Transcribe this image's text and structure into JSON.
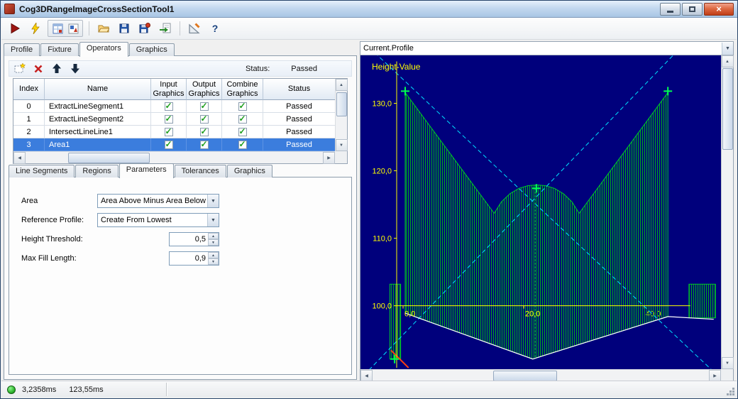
{
  "window": {
    "title": "Cog3DRangeImageCrossSectionTool1"
  },
  "glyphs": {
    "dropdown": "▼",
    "spin_up": "▲",
    "spin_down": "▼",
    "scroll_up": "▲",
    "scroll_down": "▼",
    "scroll_left": "◀",
    "scroll_right": "▶",
    "close": "×",
    "help": "?"
  },
  "toolbar": {
    "icons": {
      "run": "red-play-triangle",
      "run_once": "lightning-bolt",
      "display_grid": "grid-window",
      "display_image": "image-window",
      "open": "folder",
      "save": "floppy-disk",
      "save_record": "floppy-disk-record",
      "import": "page-import-arrow",
      "setup": "set-square-pencil",
      "help": "question-mark"
    }
  },
  "tabs": {
    "main": [
      "Profile",
      "Fixture",
      "Operators",
      "Graphics"
    ],
    "active_main": "Operators",
    "sub": [
      "Line Segments",
      "Regions",
      "Parameters",
      "Tolerances",
      "Graphics"
    ],
    "active_sub": "Parameters"
  },
  "operators": {
    "status_label": "Status:",
    "status_value": "Passed",
    "selected_index": 3,
    "columns": [
      {
        "line1": "Index",
        "line2": ""
      },
      {
        "line1": "Name",
        "line2": ""
      },
      {
        "line1": "Input",
        "line2": "Graphics"
      },
      {
        "line1": "Output",
        "line2": "Graphics"
      },
      {
        "line1": "Combine",
        "line2": "Graphics"
      },
      {
        "line1": "Status",
        "line2": ""
      }
    ],
    "rows": [
      {
        "index": "0",
        "name": "ExtractLineSegment1",
        "input_graphics": true,
        "output_graphics": true,
        "combine_graphics": true,
        "status": "Passed"
      },
      {
        "index": "1",
        "name": "ExtractLineSegment2",
        "input_graphics": true,
        "output_graphics": true,
        "combine_graphics": true,
        "status": "Passed"
      },
      {
        "index": "2",
        "name": "IntersectLineLine1",
        "input_graphics": true,
        "output_graphics": true,
        "combine_graphics": true,
        "status": "Passed"
      },
      {
        "index": "3",
        "name": "Area1",
        "input_graphics": true,
        "output_graphics": true,
        "combine_graphics": true,
        "status": "Passed"
      }
    ]
  },
  "parameters": {
    "area_label": "Area",
    "area_value": "Area Above Minus Area Below",
    "reference_profile_label": "Reference Profile:",
    "reference_profile_value": "Create From Lowest",
    "height_threshold_label": "Height Threshold:",
    "height_threshold_value": "0,5",
    "max_fill_length_label": "Max Fill Length:",
    "max_fill_length_value": "0,9"
  },
  "profile_view": {
    "selector_value": "Current.Profile"
  },
  "status_bar": {
    "time1": "3,2358ms",
    "time2": "123,55ms"
  },
  "chart_data": {
    "type": "area",
    "title": "Current.Profile",
    "axis_label": "Height-Value",
    "xlim": [
      -7.06,
      52.7
    ],
    "ylim": [
      90.6,
      137.1
    ],
    "x_axis": {
      "y": 100,
      "from": -1.06,
      "to": 47.6
    },
    "y_axis": {
      "x": -1.06,
      "top": 136.2,
      "bottom": 90.8
    },
    "x_ticks": [
      {
        "v": 0,
        "label": "0,0",
        "behind": false
      },
      {
        "v": 20,
        "label": "20,0",
        "behind": false
      },
      {
        "v": 40,
        "label": "40,0",
        "behind": true
      }
    ],
    "y_ticks": [
      {
        "v": 130,
        "label": "130,0"
      },
      {
        "v": 120,
        "label": "120,0"
      },
      {
        "v": 110,
        "label": "110,0"
      },
      {
        "v": 100,
        "label": "100,0"
      }
    ],
    "colors": {
      "background": "#00007c",
      "axis": "#ffff00",
      "hatch": "#00a820",
      "outline": "#00c92c",
      "extracted_line": "#00e0ff",
      "profile_line": "#ffffff",
      "highlight_segment": "#ff4010",
      "marker": "#00ff50",
      "center_line": "#00c040"
    },
    "hatched_regions": [
      [
        [
          0.35,
          131.6
        ],
        [
          15.1,
          113.7
        ],
        [
          16.3,
          115.4
        ],
        [
          17.7,
          116.6
        ],
        [
          19.2,
          117.4
        ],
        [
          20.7,
          117.8
        ],
        [
          22.15,
          117.9
        ],
        [
          23.6,
          117.8
        ],
        [
          25.1,
          117.4
        ],
        [
          26.6,
          116.6
        ],
        [
          28.0,
          115.4
        ],
        [
          29.2,
          113.7
        ],
        [
          43.9,
          131.6
        ],
        [
          43.9,
          98.4
        ],
        [
          21.5,
          92.1
        ],
        [
          0.35,
          98.9
        ]
      ],
      [
        [
          -2.2,
          103.2
        ],
        [
          -0.4,
          103.2
        ],
        [
          -0.4,
          92.1
        ],
        [
          -2.2,
          92.1
        ]
      ],
      [
        [
          47.4,
          103.2
        ],
        [
          51.8,
          103.2
        ],
        [
          51.8,
          98.2
        ],
        [
          47.4,
          98.2
        ]
      ]
    ],
    "extracted_lines": [
      [
        [
          -4.7,
          137.5
        ],
        [
          52.7,
          89.2
        ]
      ],
      [
        [
          -6.5,
          89.7
        ],
        [
          45.3,
          137.6
        ]
      ]
    ],
    "profile_lines": [
      [
        [
          0.35,
          98.9
        ],
        [
          21.5,
          92.1
        ],
        [
          43.9,
          98.4
        ],
        [
          51.5,
          98.0
        ]
      ]
    ],
    "highlight_segment": [
      [
        -2.0,
        93.4
      ],
      [
        0.9,
        90.8
      ]
    ],
    "center_dashed_line": [
      [
        21.9,
        117.9
      ],
      [
        21.9,
        92.3
      ]
    ],
    "intersection_point": [
      21.5,
      112.0
    ],
    "markers": [
      [
        0.35,
        131.8
      ],
      [
        43.9,
        131.8
      ],
      [
        22.1,
        117.4
      ],
      [
        -1.4,
        92.1
      ]
    ]
  }
}
